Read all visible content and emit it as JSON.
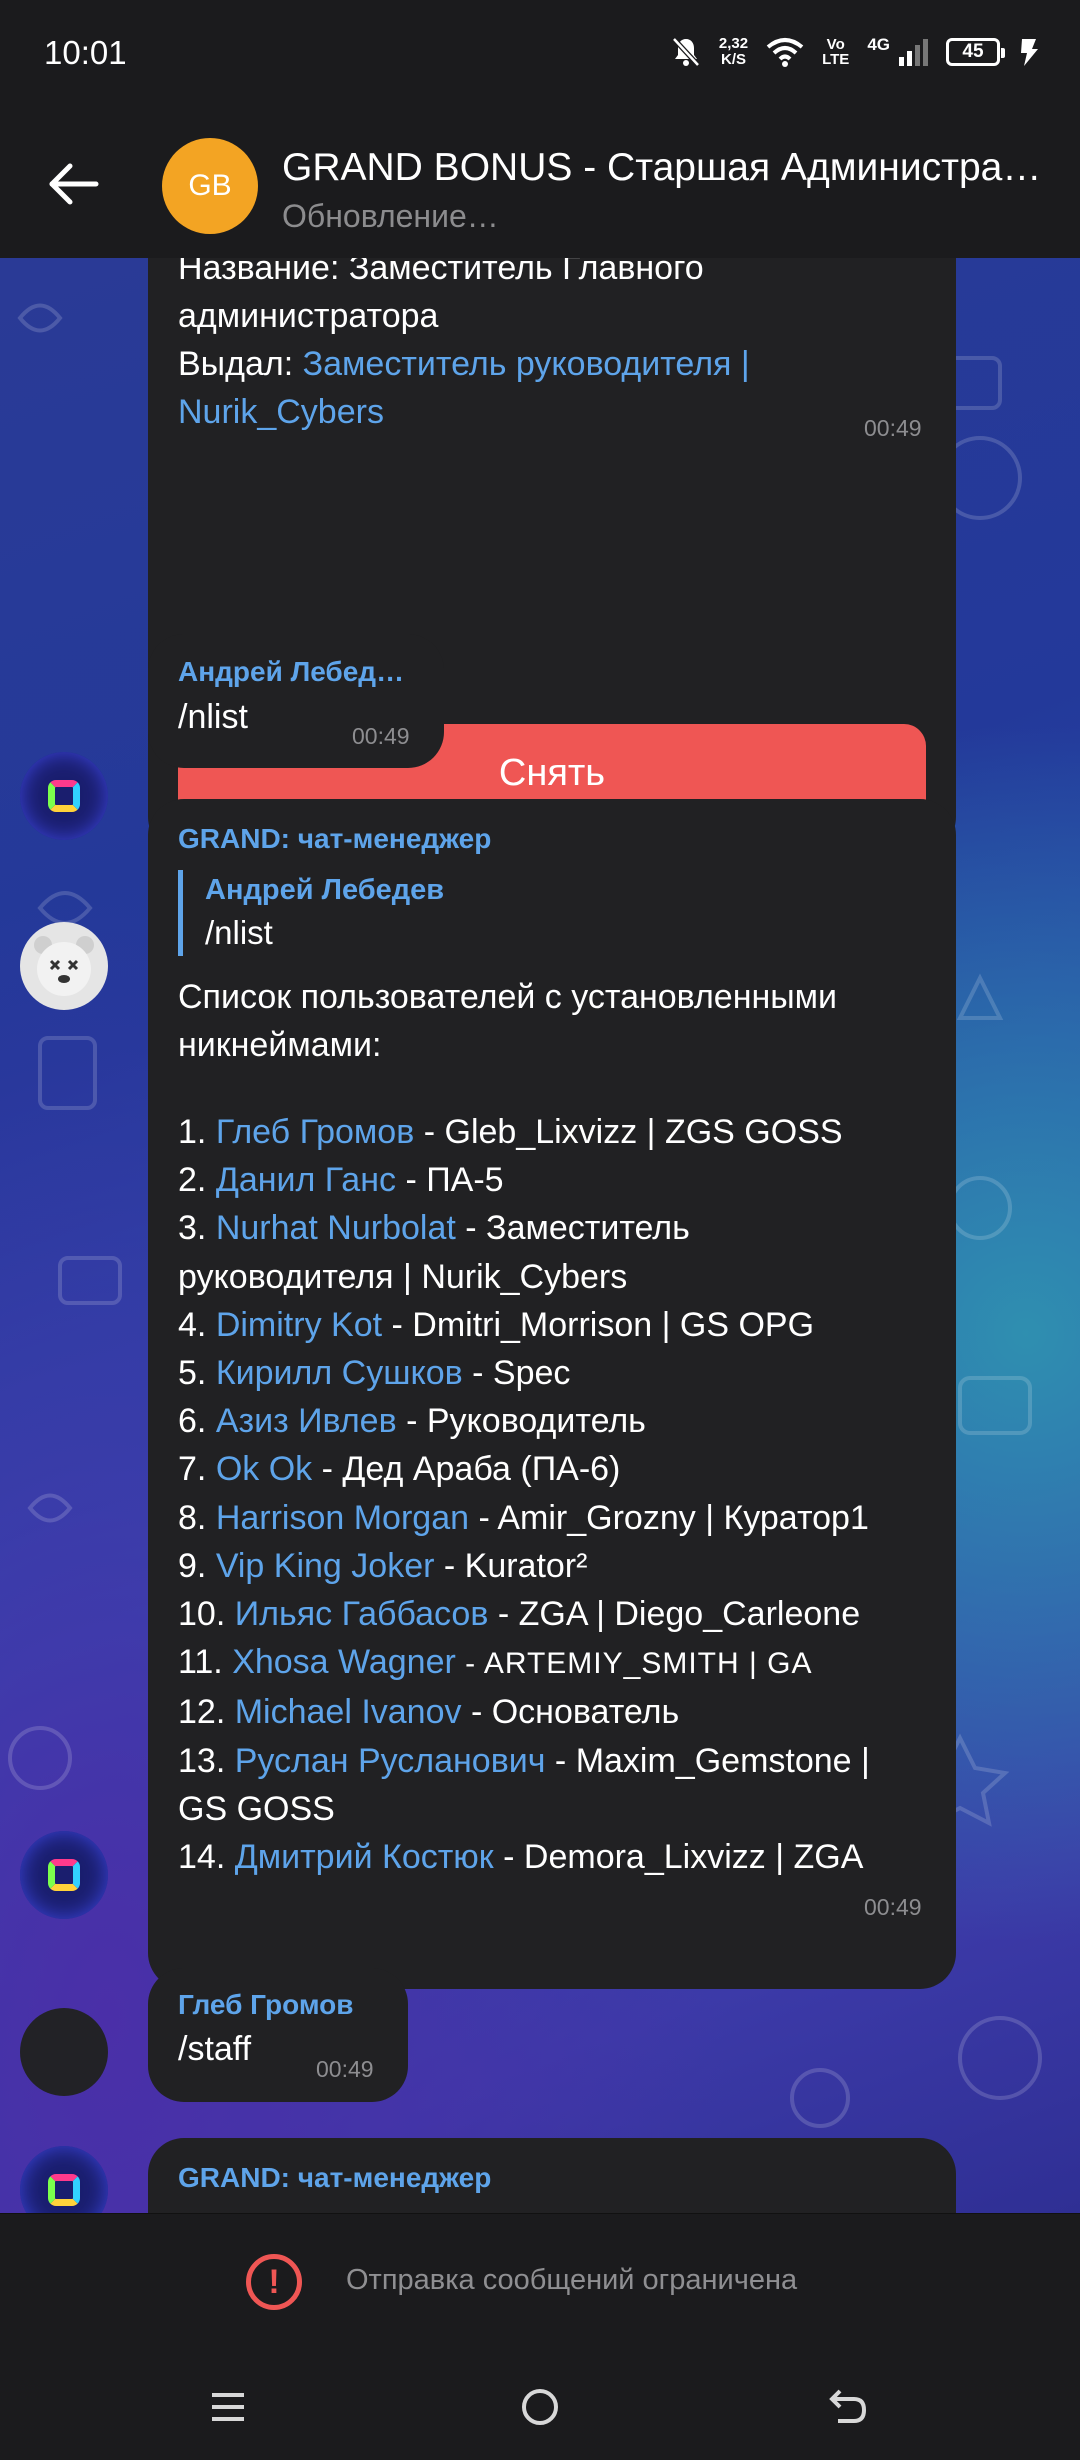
{
  "status_bar": {
    "time": "10:01",
    "speed_value": "2,32",
    "speed_unit": "K/S",
    "volte_top": "Vo",
    "volte_bottom": "LTE",
    "network": "4G",
    "battery": "45",
    "icons": [
      "mute-bell-icon",
      "wifi-icon",
      "signal-icon",
      "battery-icon",
      "charging-icon"
    ]
  },
  "header": {
    "avatar_initials": "GB",
    "avatar_color": "#f3a423",
    "title": "GRAND BONUS - Старшая Администрация",
    "subtitle": "Обновление…"
  },
  "messages": {
    "m1": {
      "line1": "Название: Заместитель Главного",
      "line2": "администратора",
      "issued_label": "Выдал: ",
      "issued_link_1": "Заместитель руководителя |",
      "issued_link_2": "Nurik_Cybers",
      "time": "00:49",
      "button": "Снять"
    },
    "m2": {
      "sender": "Андрей Лебед…",
      "text": "/nlist",
      "time": "00:49"
    },
    "m3": {
      "sender": "GRAND: чат-менеджер",
      "quote_name": "Андрей Лебедев",
      "quote_text": "/nlist",
      "intro_1": "Список пользователей с установленными",
      "intro_2": "никнеймами:",
      "list": [
        {
          "num": "1. ",
          "name": "Глеб Громов",
          "rest": " - Gleb_Lixvizz | ZGS GOSS"
        },
        {
          "num": "2. ",
          "name": "Данил Ганс",
          "rest": " - ПА-5"
        },
        {
          "num": "3. ",
          "name": "Nurhat Nurbolat",
          "rest": " - Заместитель",
          "rest2": "руководителя | Nurik_Cybers"
        },
        {
          "num": "4. ",
          "name": "Dimitry Kot",
          "rest": " - Dmitri_Morrison | GS OPG"
        },
        {
          "num": "5. ",
          "name": "Кирилл Сушков",
          "rest": " - Spec"
        },
        {
          "num": "6. ",
          "name": "Азиз Ивлев",
          "rest": " - Руководитель"
        },
        {
          "num": "7. ",
          "name": "Ok Ok",
          "rest": " - Дед Араба (ПА-6)"
        },
        {
          "num": "8. ",
          "name": "Harrison Morgan",
          "rest": " - Amir_Grozny | Куратор1"
        },
        {
          "num": "9. ",
          "name": "Vip King Joker",
          "rest": " - Kurator²"
        },
        {
          "num": "10. ",
          "name": "Ильяс Габбасов",
          "rest": " - ZGA | Diego_Carleone"
        },
        {
          "num": "11. ",
          "name": "Xhosa Wagner",
          "rest": " - ARTEMIY_SMITH | GA"
        },
        {
          "num": "12. ",
          "name": "Michael Ivanov",
          "rest": " - Основатель"
        },
        {
          "num": "13. ",
          "name": "Руслан Русланович",
          "rest": " - Maxim_Gemstone |",
          "rest2": "GS GOSS"
        },
        {
          "num": "14. ",
          "name": "Дмитрий Костюк",
          "rest": " - Demora_Lixvizz | ZGA"
        }
      ],
      "time": "00:49"
    },
    "m4": {
      "sender": "Глеб Громов",
      "text": "/staff",
      "time": "00:49"
    },
    "m5": {
      "sender": "GRAND: чат-менеджер"
    }
  },
  "bottom": {
    "restricted_text": "Отправка сообщений ограничена"
  },
  "navigation": {
    "items": [
      "menu-icon",
      "home-icon",
      "back-icon"
    ]
  },
  "colors": {
    "link": "#5ea4ea",
    "bubble": "#212123",
    "danger": "#ef5654",
    "bar": "#1b1b1d"
  }
}
